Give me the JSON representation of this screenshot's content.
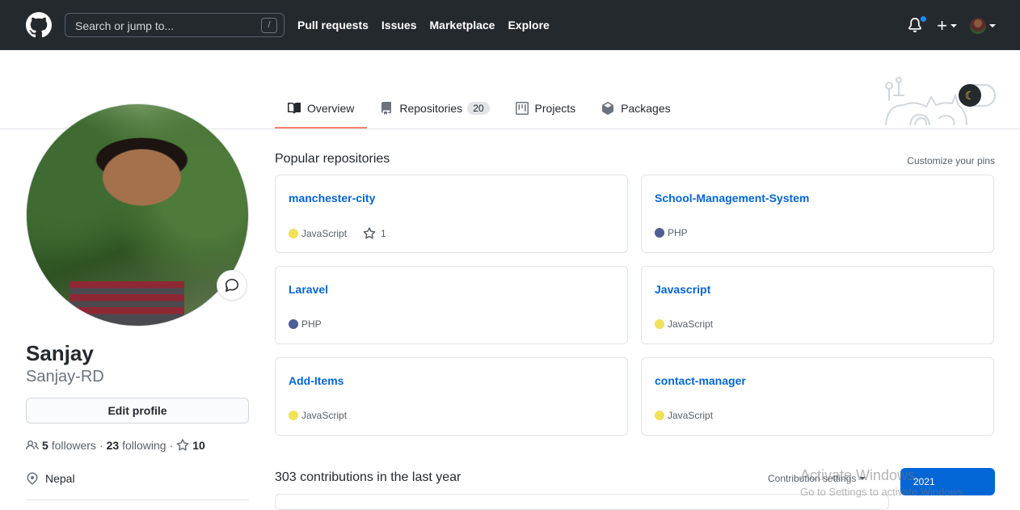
{
  "header": {
    "search_placeholder": "Search or jump to...",
    "search_shortcut": "/",
    "nav": [
      "Pull requests",
      "Issues",
      "Marketplace",
      "Explore"
    ],
    "plus": "+"
  },
  "tabs": [
    {
      "label": "Overview",
      "icon": "book-icon",
      "active": true
    },
    {
      "label": "Repositories",
      "icon": "repo-icon",
      "count": "20"
    },
    {
      "label": "Projects",
      "icon": "project-icon"
    },
    {
      "label": "Packages",
      "icon": "package-icon"
    }
  ],
  "profile": {
    "name": "Sanjay",
    "login": "Sanjay-RD",
    "edit_button": "Edit profile",
    "followers_count": "5",
    "followers_label": "followers",
    "following_count": "23",
    "following_label": "following",
    "stars_count": "10",
    "location": "Nepal"
  },
  "main": {
    "popular_title": "Popular repositories",
    "customize_pins": "Customize your pins",
    "repos": [
      {
        "name": "manchester-city",
        "language": "JavaScript",
        "color": "#f1e05a",
        "stars": "1"
      },
      {
        "name": "School-Management-System",
        "language": "PHP",
        "color": "#4F5D95"
      },
      {
        "name": "Laravel",
        "language": "PHP",
        "color": "#4F5D95"
      },
      {
        "name": "Javascript",
        "language": "JavaScript",
        "color": "#f1e05a"
      },
      {
        "name": "Add-Items",
        "language": "JavaScript",
        "color": "#f1e05a"
      },
      {
        "name": "contact-manager",
        "language": "JavaScript",
        "color": "#f1e05a"
      }
    ],
    "contributions_title": "303 contributions in the last year",
    "contribution_settings": "Contribution settings",
    "year": "2021"
  },
  "watermark": {
    "line1": "Activate Windows",
    "line2": "Go to Settings to activate Windows."
  }
}
